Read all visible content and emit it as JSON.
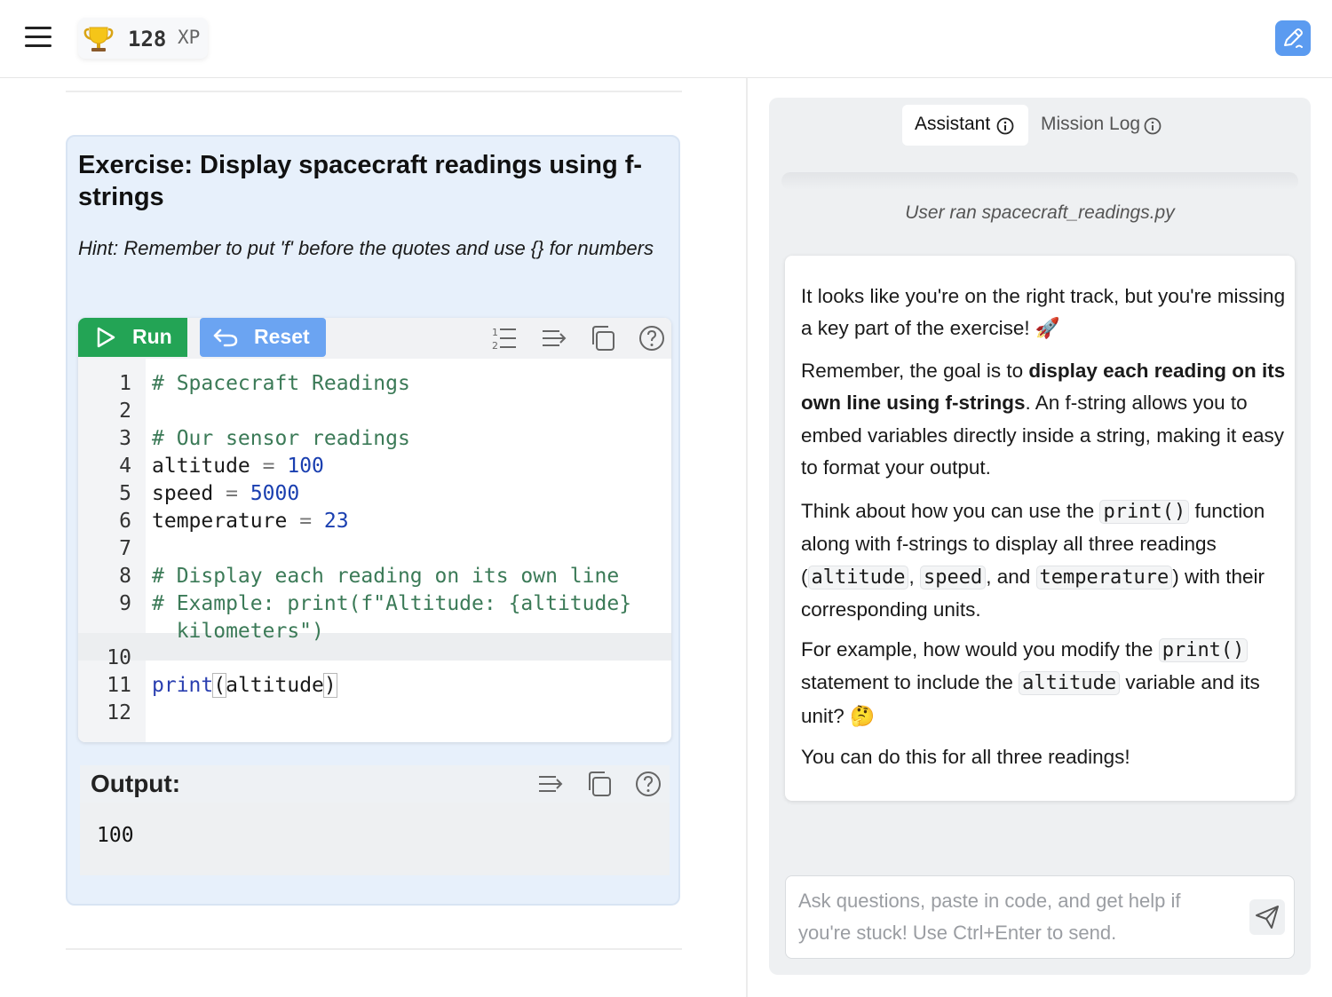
{
  "topbar": {
    "xp_value": "128",
    "xp_unit": "XP",
    "menu_icon": "hamburger-menu-icon",
    "trophy_icon": "trophy-icon",
    "edit_icon": "edit-pen-icon",
    "accent_color": "#5b9bf0"
  },
  "exercise": {
    "title": "Exercise: Display spacecraft readings using f-strings",
    "hint": "Hint: Remember to put 'f' before the quotes and use {} for numbers",
    "run_label": "Run",
    "reset_label": "Reset",
    "run_color": "#23a455",
    "reset_color": "#6ba4f2",
    "toolbar_icons": [
      "line-numbers-icon",
      "wrap-icon",
      "copy-icon",
      "help-icon"
    ],
    "line_numbers": [
      "1",
      "2",
      "3",
      "4",
      "5",
      "6",
      "7",
      "8",
      "9",
      "",
      "10",
      "11",
      "12"
    ],
    "code": {
      "l1": "# Spacecraft Readings",
      "l3": "# Our sensor readings",
      "l4_var": "altitude",
      "l4_op": "=",
      "l4_val": "100",
      "l5_var": "speed",
      "l5_op": "=",
      "l5_val": "5000",
      "l6_var": "temperature",
      "l6_op": "=",
      "l6_val": "23",
      "l8": "# Display each reading on its own line",
      "l9": "# Example: print(f\"Altitude: {altitude}",
      "l9b": "  kilometers\")",
      "l11_fn": "print",
      "l11_open": "(",
      "l11_arg": "altitude",
      "l11_close": ")"
    },
    "output_title": "Output:",
    "output_text": "100"
  },
  "assistant": {
    "tab_assistant": "Assistant",
    "tab_mission_log": "Mission Log",
    "ran_note": "User ran spacecraft_readings.py",
    "msg": {
      "p1": "It looks like you're on the right track, but you're missing a key part of the exercise! 🚀",
      "p2_a": "Remember, the goal is to ",
      "p2_b": "display each reading on its own line using f-strings",
      "p2_c": ". An f-string allows you to embed variables directly inside a string, making it easy to format your output.",
      "p3_a": "Think about how you can use the ",
      "p3_code1": "print()",
      "p3_b": " function along with f-strings to display all three readings (",
      "p3_code2": "altitude",
      "p3_c": ", ",
      "p3_code3": "speed",
      "p3_d": ", and ",
      "p3_code4": "temperature",
      "p3_e": ") with their corresponding units.",
      "p4_a": "For example, how would you modify the ",
      "p4_code1": "print()",
      "p4_b": " statement to include the ",
      "p4_code2": "altitude",
      "p4_c": " variable and its unit? 🤔",
      "p5": "You can do this for all three readings!"
    },
    "input_placeholder": "Ask questions, paste in code, and get help if you're stuck! Use Ctrl+Enter to send.",
    "send_icon": "send-paper-plane-icon"
  }
}
